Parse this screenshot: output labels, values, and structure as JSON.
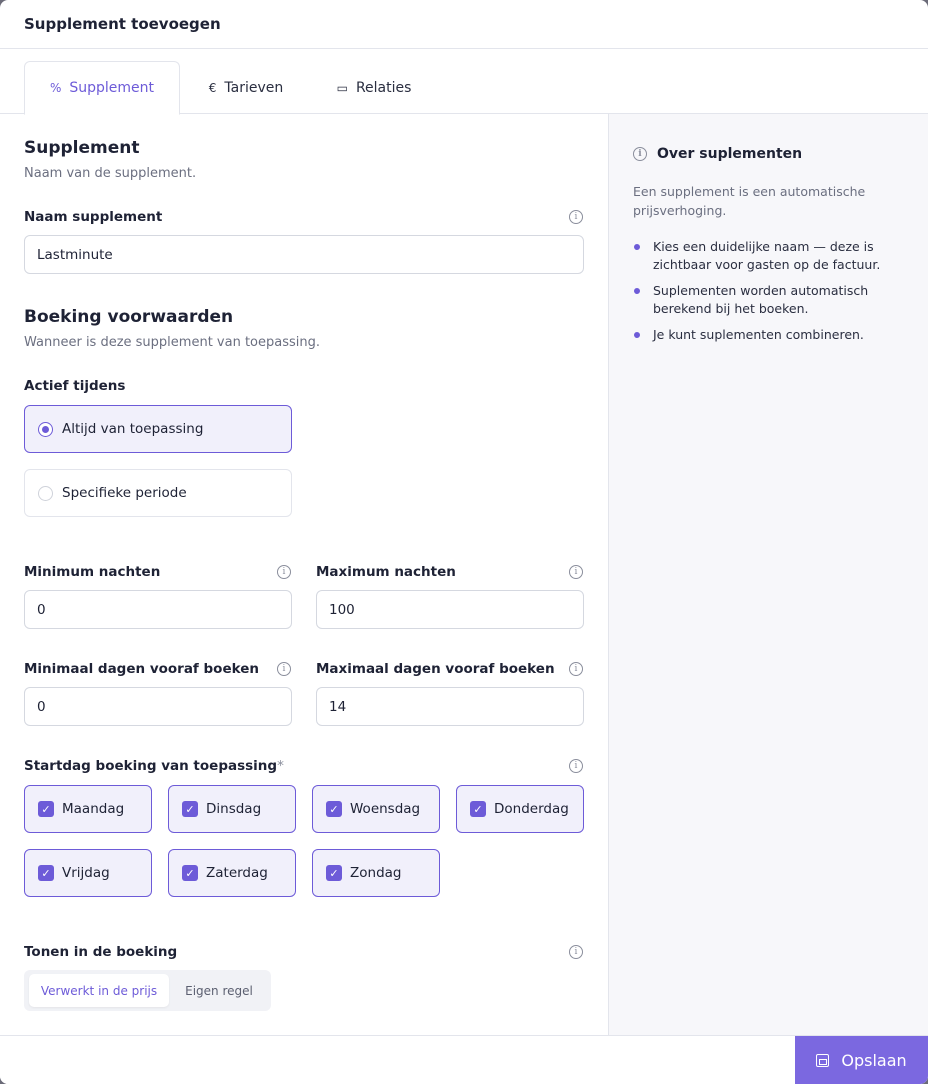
{
  "header": {
    "title": "Supplement toevoegen"
  },
  "tabs": [
    {
      "icon": "%",
      "label": "Supplement"
    },
    {
      "icon": "€",
      "label": "Tarieven"
    },
    {
      "icon": "▭",
      "label": "Relaties"
    }
  ],
  "supplement": {
    "title": "Supplement",
    "subtitle": "Naam van de supplement.",
    "name_label": "Naam supplement",
    "name_value": "Lastminute"
  },
  "conditions": {
    "title": "Boeking voorwaarden",
    "subtitle": "Wanneer is deze supplement van toepassing.",
    "active_label": "Actief tijdens",
    "options": [
      "Altijd van toepassing",
      "Specifieke periode"
    ],
    "selected_option": "Altijd van toepassing",
    "min_nights_label": "Minimum nachten",
    "min_nights_value": "0",
    "max_nights_label": "Maximum nachten",
    "max_nights_value": "100",
    "min_days_label": "Minimaal dagen vooraf boeken",
    "min_days_value": "0",
    "max_days_label": "Maximaal dagen vooraf boeken",
    "max_days_value": "14",
    "startday_label": "Startdag boeking van toepassing",
    "required_mark": "*",
    "days": [
      "Maandag",
      "Dinsdag",
      "Woensdag",
      "Donderdag",
      "Vrijdag",
      "Zaterdag",
      "Zondag"
    ],
    "days_checked": [
      true,
      true,
      true,
      true,
      true,
      true,
      true
    ],
    "display_label": "Tonen in de boeking",
    "display_options": [
      "Verwerkt in de prijs",
      "Eigen regel"
    ],
    "display_selected": "Verwerkt in de prijs"
  },
  "sidebar": {
    "title": "Over suplementen",
    "intro": "Een supplement is een automatische prijsverhoging.",
    "bullets": [
      "Kies een duidelijke naam — deze is zichtbaar voor gasten op de factuur.",
      "Suplementen worden automatisch berekend bij het boeken.",
      "Je kunt suplementen combineren."
    ]
  },
  "footer": {
    "save_label": "Opslaan"
  },
  "colors": {
    "accent": "#6d5bd8",
    "save_button": "#7b68e0"
  }
}
